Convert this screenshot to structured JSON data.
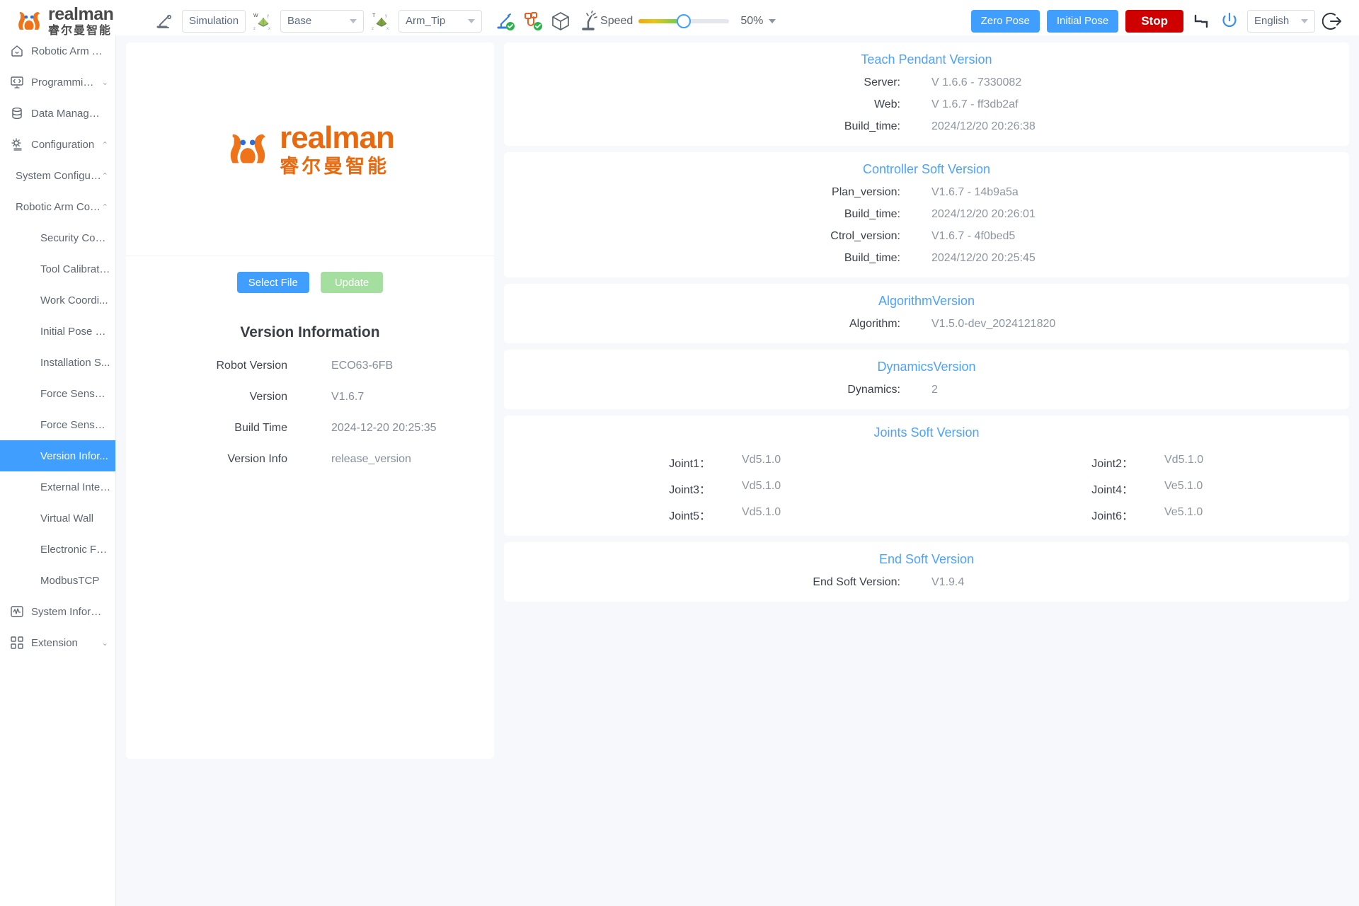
{
  "brand": {
    "en": "realman",
    "cn": "睿尔曼智能"
  },
  "toolbar": {
    "robot_icon": "robot-arm-icon",
    "mode_value": "Simulation",
    "base_frame_icon": "world-coordinate-icon",
    "base_frame": "Base",
    "tool_frame_icon": "tool-coordinate-icon",
    "tool_frame": "Arm_Tip",
    "teach_status_icon": "robot-connected-icon",
    "io_status_icon": "cable-connected-icon",
    "model_icon": "cube-icon",
    "collision_icon": "collision-icon",
    "speed_label": "Speed",
    "speed_percent": "50%",
    "speed_value": 50,
    "zero_pose": "Zero Pose",
    "initial_pose": "Initial Pose",
    "stop": "Stop",
    "drag_icon": "drag-teach-icon",
    "power_icon": "power-icon",
    "language": "English",
    "logout_icon": "logout-icon"
  },
  "sidebar": {
    "items": [
      {
        "label": "Robotic Arm Tea...",
        "icon": "home-icon",
        "arrow": ""
      },
      {
        "label": "Programming",
        "icon": "code-monitor-icon",
        "arrow": "⌄"
      },
      {
        "label": "Data Management",
        "icon": "database-icon",
        "arrow": ""
      },
      {
        "label": "Configuration",
        "icon": "gear-list-icon",
        "arrow": "⌃"
      }
    ],
    "sub_items": [
      {
        "label": "System Configuration",
        "arrow": "⌃"
      },
      {
        "label": "Robotic Arm Config.",
        "arrow": "⌃"
      }
    ],
    "leaf_items": [
      {
        "label": "Security Conf...",
        "active": false
      },
      {
        "label": "Tool Calibration",
        "active": false
      },
      {
        "label": "Work Coordi...",
        "active": false
      },
      {
        "label": "Initial Pose S...",
        "active": false
      },
      {
        "label": "Installation S...",
        "active": false
      },
      {
        "label": "Force Sensor...",
        "active": false
      },
      {
        "label": "Force Sensor...",
        "active": false
      },
      {
        "label": "Version Infor...",
        "active": true
      },
      {
        "label": "External Inter...",
        "active": false
      },
      {
        "label": "Virtual Wall",
        "active": false
      },
      {
        "label": "Electronic Fe...",
        "active": false
      },
      {
        "label": "ModbusTCP",
        "active": false
      }
    ],
    "bottom_items": [
      {
        "label": "System Informat...",
        "icon": "pulse-icon",
        "arrow": ""
      },
      {
        "label": "Extension",
        "icon": "grid-icon",
        "arrow": "⌄"
      }
    ]
  },
  "left_panel": {
    "select_file": "Select File",
    "update": "Update",
    "title": "Version Information",
    "rows": [
      {
        "key": "Robot Version",
        "value": "ECO63-6FB"
      },
      {
        "key": "Version",
        "value": "V1.6.7"
      },
      {
        "key": "Build Time",
        "value": "2024-12-20 20:25:35"
      },
      {
        "key": "Version Info",
        "value": "release_version"
      }
    ]
  },
  "sections": [
    {
      "title": "Teach Pendant Version",
      "rows": [
        {
          "key": "Server:",
          "value": "V 1.6.6 - 7330082"
        },
        {
          "key": "Web:",
          "value": "V 1.6.7 - ff3db2af"
        },
        {
          "key": "Build_time:",
          "value": "2024/12/20 20:26:38"
        }
      ]
    },
    {
      "title": "Controller Soft Version",
      "rows": [
        {
          "key": "Plan_version:",
          "value": "V1.6.7 - 14b9a5a"
        },
        {
          "key": "Build_time:",
          "value": "2024/12/20 20:26:01"
        },
        {
          "key": "Ctrol_version:",
          "value": "V1.6.7 - 4f0bed5"
        },
        {
          "key": "Build_time:",
          "value": "2024/12/20 20:25:45"
        }
      ]
    },
    {
      "title": "AlgorithmVersion",
      "rows": [
        {
          "key": "Algorithm:",
          "value": "V1.5.0-dev_2024121820"
        }
      ]
    },
    {
      "title": "DynamicsVersion",
      "rows": [
        {
          "key": "Dynamics:",
          "value": "2"
        }
      ]
    }
  ],
  "joints_section": {
    "title": "Joints Soft Version",
    "joints": [
      {
        "key": "Joint1：",
        "value": "Vd5.1.0"
      },
      {
        "key": "Joint2：",
        "value": "Vd5.1.0"
      },
      {
        "key": "Joint3：",
        "value": "Vd5.1.0"
      },
      {
        "key": "Joint4：",
        "value": "Ve5.1.0"
      },
      {
        "key": "Joint5：",
        "value": "Vd5.1.0"
      },
      {
        "key": "Joint6：",
        "value": "Ve5.1.0"
      }
    ]
  },
  "end_section": {
    "title": "End Soft Version",
    "rows": [
      {
        "key": "End Soft Version:",
        "value": "V1.9.4"
      }
    ]
  },
  "colors": {
    "accent_blue": "#409eff",
    "title_blue": "#4ba3ff",
    "danger_red": "#cf0000",
    "brand_orange": "#e8690e",
    "update_green": "#a5dfa0"
  }
}
